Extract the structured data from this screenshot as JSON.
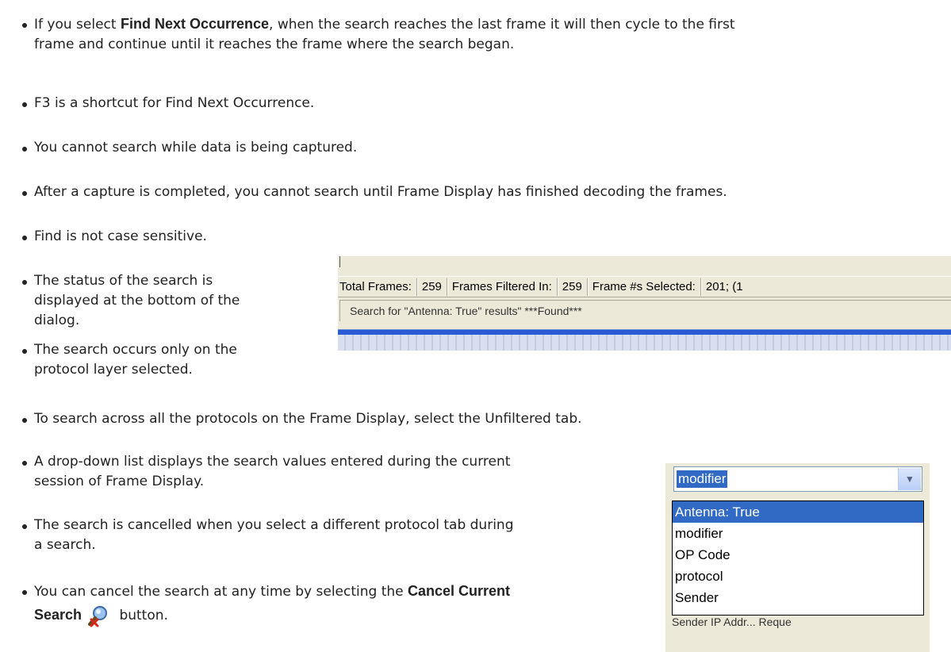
{
  "bullets": {
    "b1_prefix": "If you select ",
    "b1_bold": "Find Next Occurrence",
    "b1_rest_line1": ", when the search reaches the last frame it will then cycle to the first",
    "b1_line2": "frame and continue until it reaches the frame where the search began.",
    "b2": "F3 is a shortcut for Find Next Occurrence.",
    "b3": "You cannot search while data is being captured.",
    "b4": "After a capture is completed, you cannot search until Frame Display has finished decoding the frames.",
    "b5": "Find is not case sensitive.",
    "b6_line1": "The status of the search is",
    "b6_line2": "displayed at the bottom of the",
    "b6_line3": "dialog.",
    "b7_line1": "The search occurs only on the",
    "b7_line2": "protocol layer selected.",
    "b8": "To search across all the protocols on the Frame Display, select the Unfiltered tab.",
    "b9_line1": "A drop-down list displays the search values entered during the current",
    "b9_line2": "session of Frame Display.",
    "b10_line1": "The search is cancelled when you select a different protocol tab during",
    "b10_line2": "a search.",
    "b11_prefix": "You can cancel the search at any time by selecting the ",
    "b11_bold1": "Cancel Current",
    "b11_bold2": "Search",
    "b11_suffix": " button."
  },
  "status_bar": {
    "total_frames_label": "Total Frames:",
    "total_frames_value": "259",
    "filtered_label": "Frames Filtered In:",
    "filtered_value": "259",
    "selected_label": "Frame #s Selected:",
    "selected_value": "201; (1",
    "search_status": "Search for \"Antenna: True\" results\" ***Found***"
  },
  "dropdown": {
    "current_value": "modifier",
    "options": [
      "Antenna: True",
      "modifier",
      "OP Code",
      "protocol",
      "Sender"
    ],
    "selected_option": "Antenna: True",
    "below_text": "Sender IP Addr...   Reque"
  },
  "icons": {
    "cancel_search": "cancel-search-icon",
    "dropdown_arrow": "chevron-down-icon"
  }
}
